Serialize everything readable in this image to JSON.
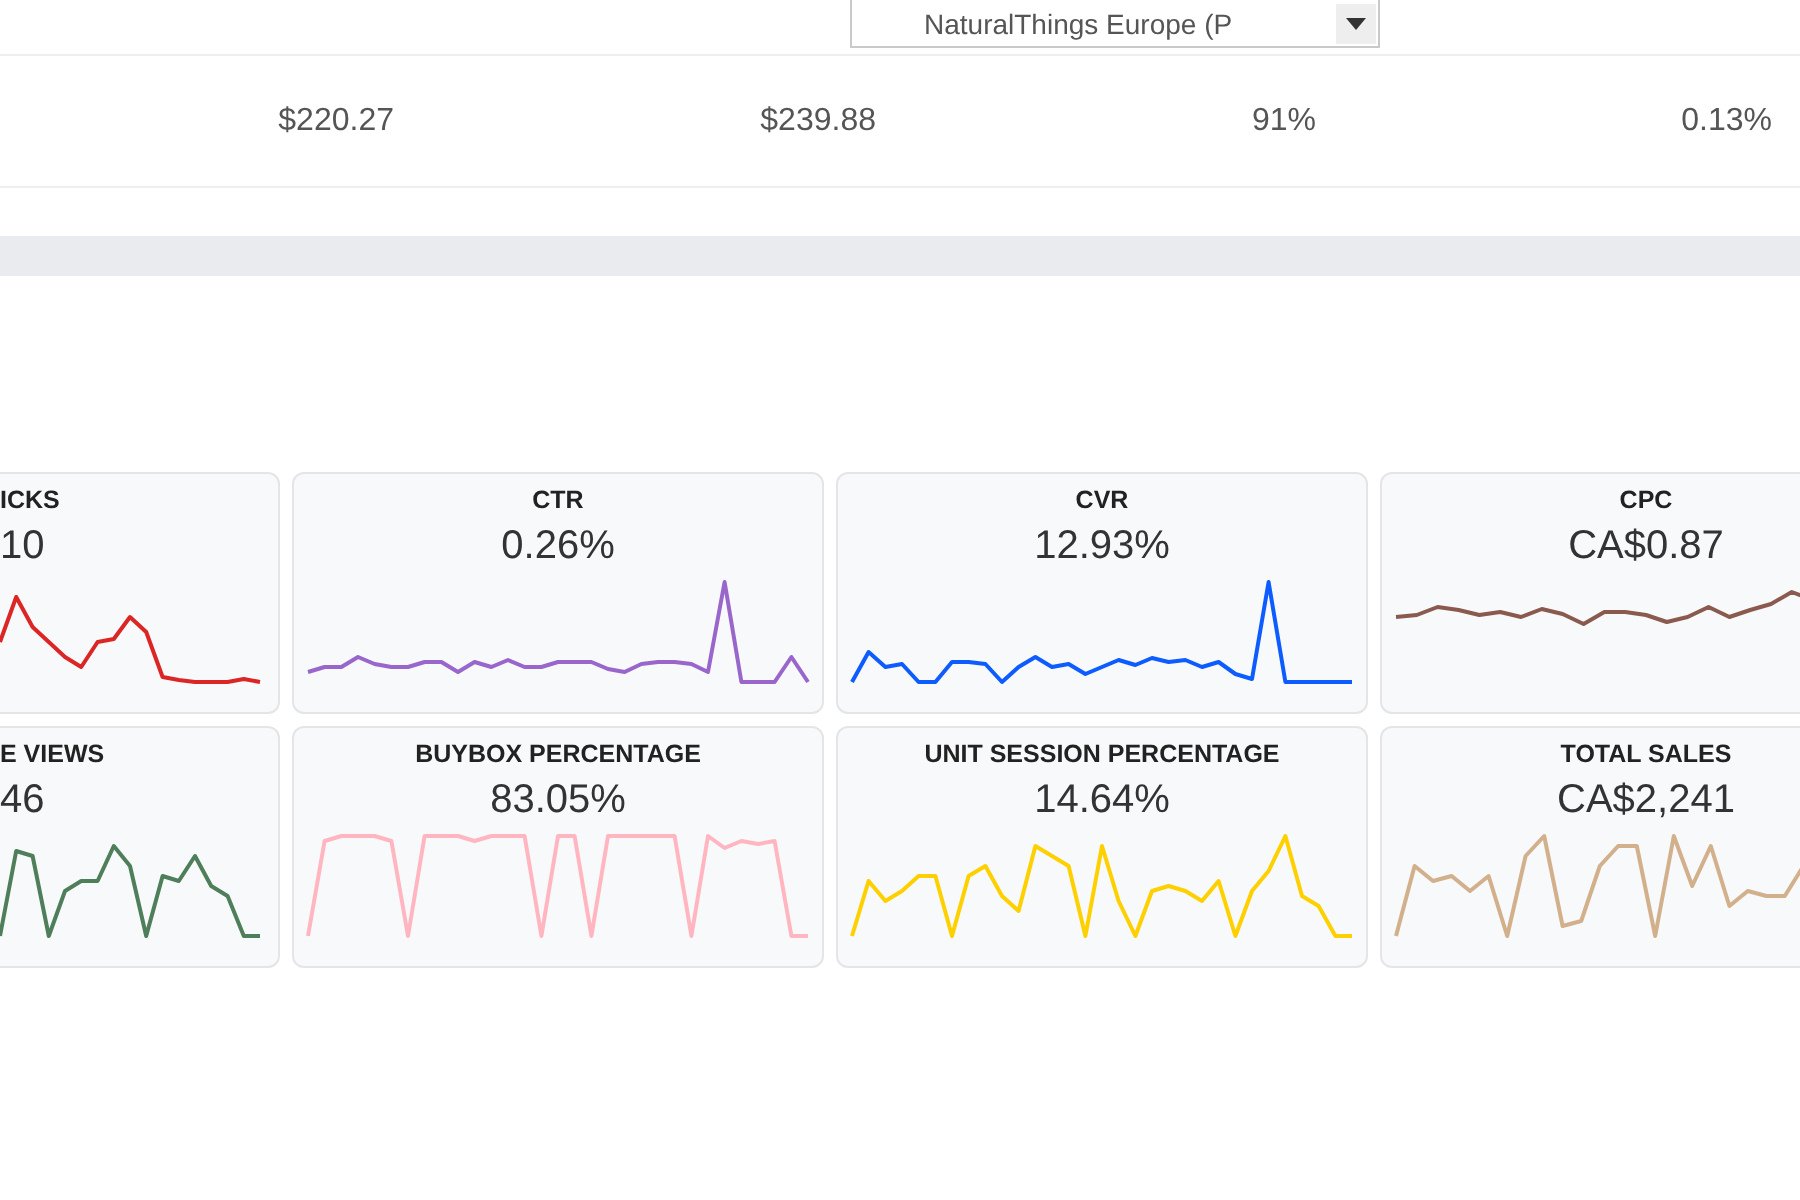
{
  "dropdown": {
    "value": "NaturalThings Europe (P"
  },
  "table": {
    "rows": [
      {
        "cells": [
          "$220.27",
          "$239.88",
          "91%",
          "0.13%"
        ]
      }
    ]
  },
  "metrics": [
    {
      "title": "ICKS",
      "value": "10",
      "color": "#dc2626"
    },
    {
      "title": "CTR",
      "value": "0.26%",
      "color": "#9966cc"
    },
    {
      "title": "CVR",
      "value": "12.93%",
      "color": "#0d5cff"
    },
    {
      "title": "CPC",
      "value": "CA$0.87",
      "color": "#8b5a4e"
    },
    {
      "title": "E VIEWS",
      "value": "46",
      "color": "#4f7f5a"
    },
    {
      "title": "BUYBOX PERCENTAGE",
      "value": "83.05%",
      "color": "#ffb6c1"
    },
    {
      "title": "UNIT SESSION PERCENTAGE",
      "value": "14.64%",
      "color": "#ffd000"
    },
    {
      "title": "TOTAL SALES",
      "value": "CA$2,241",
      "color": "#d2b08c"
    }
  ]
}
